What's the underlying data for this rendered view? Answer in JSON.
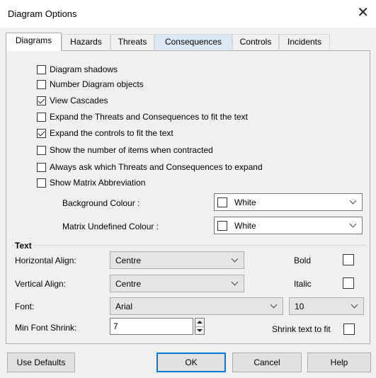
{
  "window": {
    "title": "Diagram Options",
    "close_glyph": "✕"
  },
  "tabs": [
    {
      "label": "Diagrams"
    },
    {
      "label": "Hazards"
    },
    {
      "label": "Threats"
    },
    {
      "label": "Consequences"
    },
    {
      "label": "Controls"
    },
    {
      "label": "Incidents"
    }
  ],
  "options": [
    {
      "label": "Diagram shadows",
      "checked": false
    },
    {
      "label": "Number Diagram objects",
      "checked": false
    },
    {
      "label": "View Cascades",
      "checked": true
    },
    {
      "label": "Expand the Threats and Consequences to fit the text",
      "checked": false
    },
    {
      "label": "Expand the controls to fit the text",
      "checked": true
    },
    {
      "label": "Show the number of items when contracted",
      "checked": false
    },
    {
      "label": "Always ask which Threats and Consequences to expand",
      "checked": false
    },
    {
      "label": "Show Matrix Abbreviation",
      "checked": false
    }
  ],
  "colours": {
    "background_label": "Background Colour :",
    "background_value": "White",
    "matrix_label": "Matrix Undefined Colour :",
    "matrix_value": "White"
  },
  "text_group": {
    "heading": "Text",
    "h_align_label": "Horizontal Align:",
    "h_align_value": "Centre",
    "v_align_label": "Vertical Align:",
    "v_align_value": "Centre",
    "font_label": "Font:",
    "font_value": "Arial",
    "size_value": "10",
    "min_shrink_label": "Min Font Shrink:",
    "min_shrink_value": "7",
    "bold_label": "Bold",
    "bold_checked": false,
    "italic_label": "Italic",
    "italic_checked": false,
    "shrink_label": "Shrink text to fit",
    "shrink_checked": false
  },
  "buttons": {
    "defaults": "Use Defaults",
    "ok": "OK",
    "cancel": "Cancel",
    "help": "Help"
  }
}
